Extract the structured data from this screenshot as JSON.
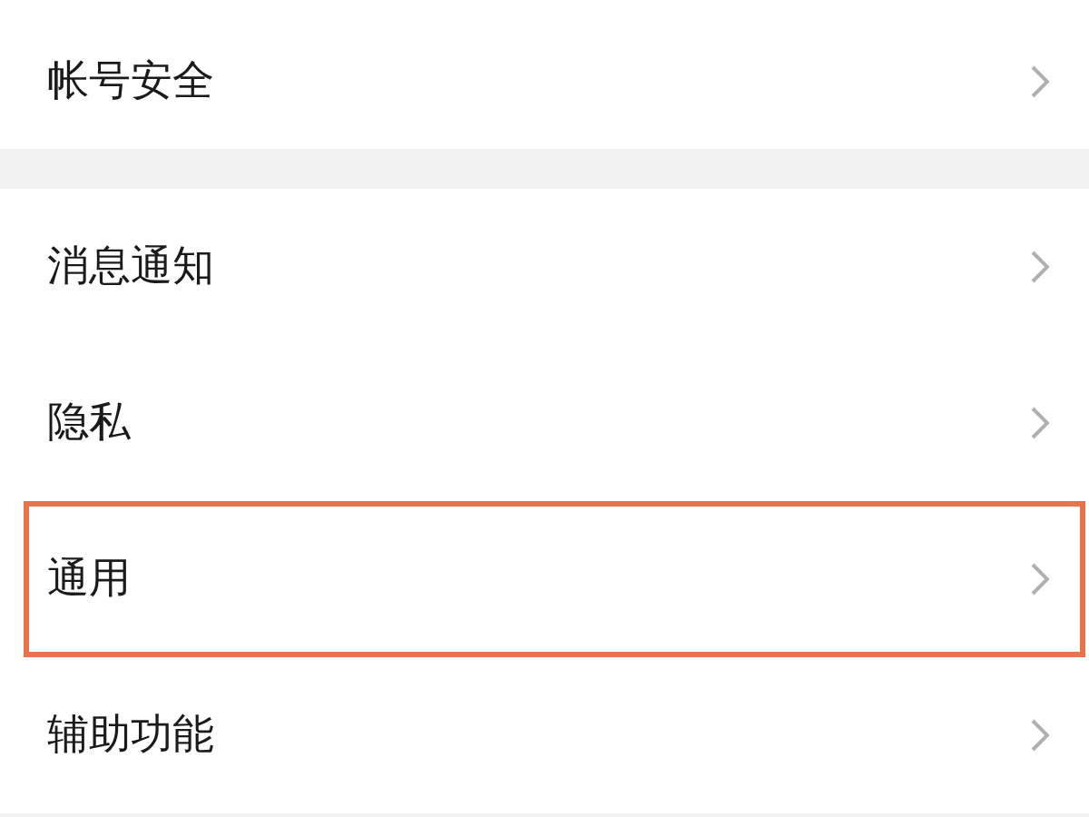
{
  "groups": [
    {
      "items": [
        {
          "label": "帐号安全",
          "highlighted": false
        }
      ]
    },
    {
      "items": [
        {
          "label": "消息通知",
          "highlighted": false
        },
        {
          "label": "隐私",
          "highlighted": false
        },
        {
          "label": "通用",
          "highlighted": true
        },
        {
          "label": "辅助功能",
          "highlighted": false
        }
      ]
    }
  ]
}
